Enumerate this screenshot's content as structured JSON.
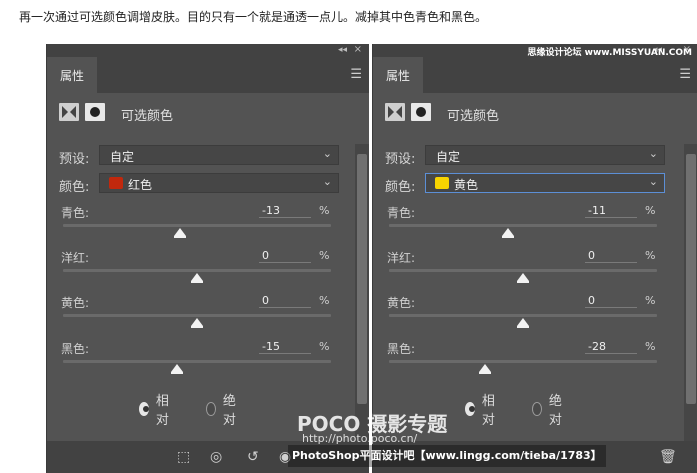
{
  "caption": "再一次通过可选颜色调增皮肤。目的只有一个就是通透一点儿。减掉其中色青色和黑色。",
  "watermark_top": "思缘设计论坛 www.MISSYUAN.COM",
  "watermark_poco": "POCO 摄影专题",
  "watermark_poco_url": "http://photo.poco.cn/",
  "watermark_bottom": "PhotoShop平面设计吧【www.lingg.com/tieba/1783】",
  "panels": [
    {
      "tab_label": "属性",
      "adj_title": "可选颜色",
      "preset_label": "预设:",
      "preset_value": "自定",
      "color_label": "颜色:",
      "color_value": "红色",
      "swatch_color": "#c2280d",
      "sliders": [
        {
          "label": "青色:",
          "value": "-13",
          "unit": "%",
          "level": -13
        },
        {
          "label": "洋红:",
          "value": "0",
          "unit": "%",
          "level": 0
        },
        {
          "label": "黄色:",
          "value": "0",
          "unit": "%",
          "level": 0
        },
        {
          "label": "黑色:",
          "value": "-15",
          "unit": "%",
          "level": -15
        }
      ],
      "mode_options": [
        {
          "label": "相对",
          "checked": true
        },
        {
          "label": "绝对",
          "checked": false
        }
      ]
    },
    {
      "tab_label": "属性",
      "adj_title": "可选颜色",
      "preset_label": "预设:",
      "preset_value": "自定",
      "color_label": "颜色:",
      "color_value": "黄色",
      "swatch_color": "#f7d300",
      "sliders": [
        {
          "label": "青色:",
          "value": "-11",
          "unit": "%",
          "level": -11
        },
        {
          "label": "洋红:",
          "value": "0",
          "unit": "%",
          "level": 0
        },
        {
          "label": "黄色:",
          "value": "0",
          "unit": "%",
          "level": 0
        },
        {
          "label": "黑色:",
          "value": "-28",
          "unit": "%",
          "level": -28
        }
      ],
      "mode_options": [
        {
          "label": "相对",
          "checked": true
        },
        {
          "label": "绝对",
          "checked": false
        }
      ]
    }
  ]
}
